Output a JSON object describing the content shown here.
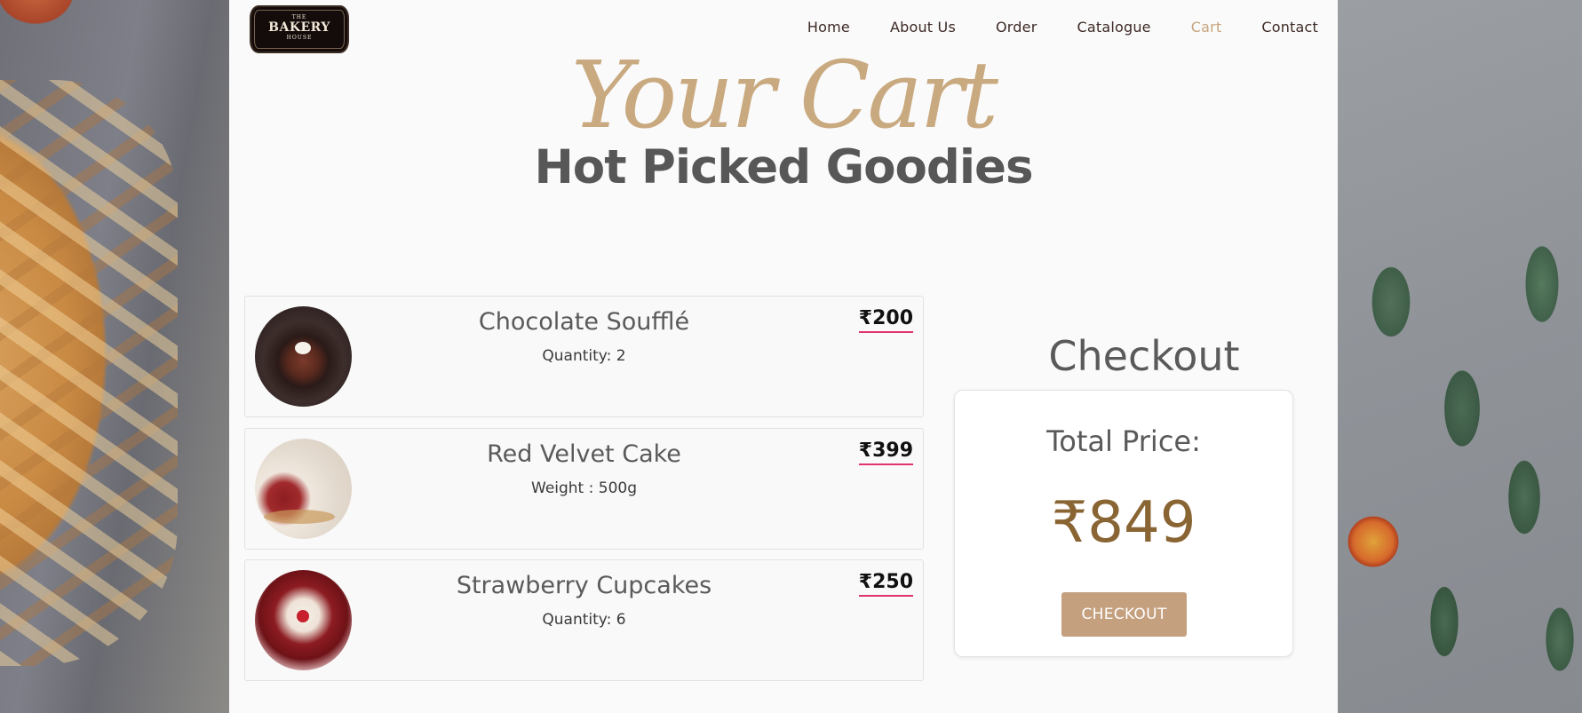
{
  "brand": {
    "logo_top": "THE",
    "logo_main": "BAKERY",
    "logo_bottom": "HOUSE"
  },
  "nav": {
    "items": [
      {
        "label": "Home"
      },
      {
        "label": "About Us"
      },
      {
        "label": "Order"
      },
      {
        "label": "Catalogue"
      },
      {
        "label": "Cart",
        "active": true
      },
      {
        "label": "Contact"
      }
    ]
  },
  "hero": {
    "script_title": "Your Cart",
    "title": "Hot Picked Goodies"
  },
  "cart": {
    "items": [
      {
        "name": "Chocolate Soufflé",
        "detail": "Quantity: 2",
        "price": "₹200",
        "image": "chocolate-souffle-photo"
      },
      {
        "name": "Red Velvet Cake",
        "detail": "Weight : 500g",
        "price": "₹399",
        "image": "red-velvet-cake-photo"
      },
      {
        "name": "Strawberry Cupcakes",
        "detail": "Quantity: 6",
        "price": "₹250",
        "image": "strawberry-cupcakes-photo"
      }
    ]
  },
  "checkout": {
    "heading": "Checkout",
    "total_label": "Total Price:",
    "total_value": "₹849",
    "button_label": "CHECKOUT"
  },
  "colors": {
    "accent": "#c7a57e",
    "button": "#c4a07f",
    "price_underline": "#e0336f",
    "total_price": "#8a6534"
  }
}
